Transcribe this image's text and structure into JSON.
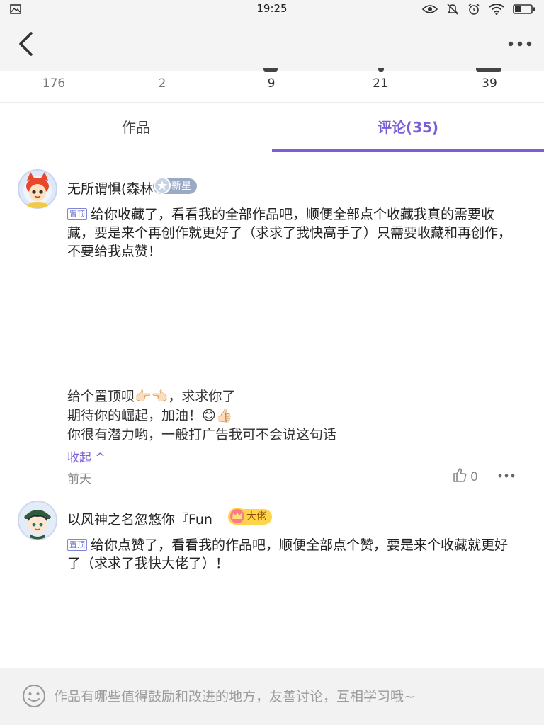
{
  "status_bar": {
    "time": "19:25",
    "left_icons": [
      "gallery-icon"
    ],
    "right_icons": [
      "eye-icon",
      "mute-icon",
      "alarm-icon",
      "wifi-icon",
      "battery-icon"
    ]
  },
  "navbar": {
    "back_icon": "chevron-left-icon",
    "menu_icon": "more-horizontal-icon"
  },
  "stats": {
    "values": [
      "176",
      "2",
      "9",
      "21",
      "39"
    ]
  },
  "tabs": {
    "works": "作品",
    "comments": "评论(35)",
    "active": "comments"
  },
  "comments": [
    {
      "username": "无所谓惧(森林",
      "badge": "新星",
      "pinned_label": "置顶",
      "text": "给你收藏了，看看我的全部作品吧，顺便全部点个收藏我真的需要收藏，要是来个再创作就更好了（求求了我快高手了）只需要收藏和再创作，不要给我点赞！",
      "replies": [
        "给个置顶呗👉🏻👈🏻，求求你了",
        "期待你的崛起，加油！😊👍🏻",
        "你很有潜力哟，一般打广告我可不会说这句话"
      ],
      "collapse_label": "收起 ^",
      "time": "前天",
      "likes": "0"
    },
    {
      "username": "以风神之名忽悠你『Fun",
      "badge": "大佬",
      "pinned_label": "置顶",
      "text": "给你点赞了，看看我的作品吧，顺便全部点个赞，要是来个收藏就更好了（求求了我快大佬了）！"
    }
  ],
  "comment_input": {
    "placeholder": "作品有哪些值得鼓励和改进的地方，友善讨论，互相学习哦~"
  },
  "colors": {
    "accent": "#7b5dd6",
    "bar_bg": "#f4f4f4",
    "badge_star": "#9aa9c4",
    "badge_gold": "#ffd44a"
  }
}
